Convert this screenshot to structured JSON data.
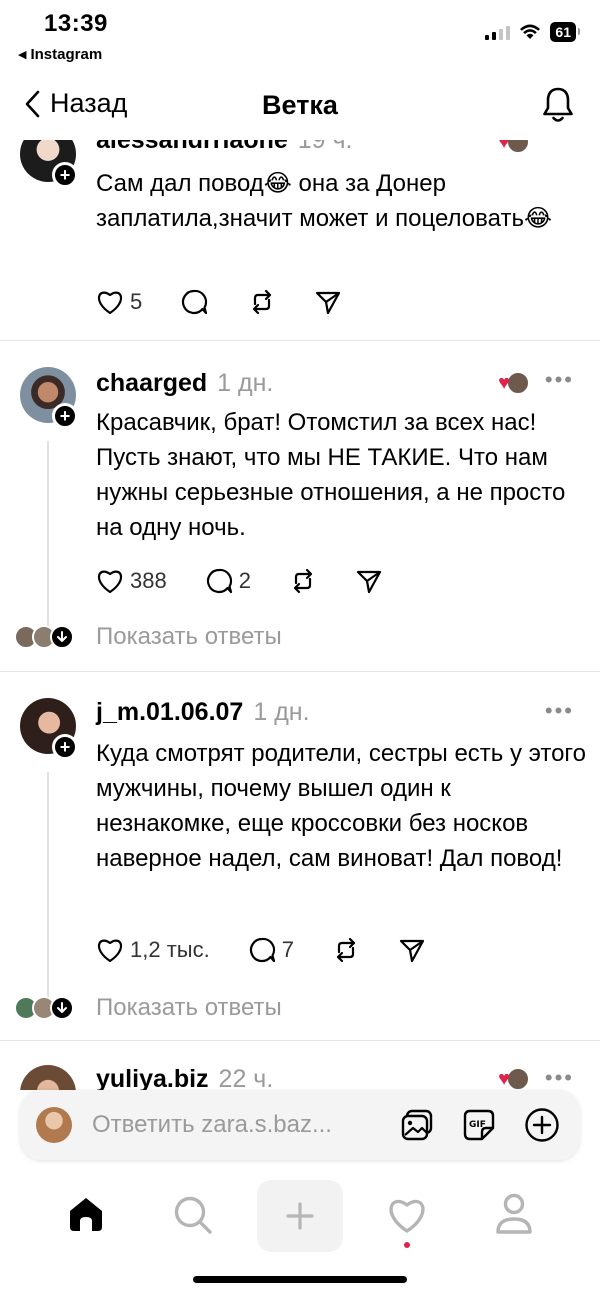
{
  "status_bar": {
    "time": "13:39",
    "back_app": "Instagram",
    "battery": "61"
  },
  "header": {
    "back_label": "Назад",
    "title": "Ветка"
  },
  "posts": [
    {
      "username": "alessandrriaone",
      "timestamp": "19 ч.",
      "text": "Сам дал повод😂 она за Донер заплатила,значит может и поцеловать😂",
      "likes": "5",
      "replies": ""
    },
    {
      "username": "chaarged",
      "timestamp": "1 дн.",
      "text": "Красавчик, брат! Отомстил за всех нас! Пусть знают, что мы НЕ ТАКИЕ. Что нам нужны серьезные отношения, а не просто на одну ночь.",
      "likes": "388",
      "replies": "2",
      "show_replies": "Показать ответы"
    },
    {
      "username": "j_m.01.06.07",
      "timestamp": "1 дн.",
      "text": "Куда смотрят родители, сестры есть у этого мужчины, почему вышел один к незнакомке,  еще кроссовки без носков наверное надел, сам виноват! Дал повод!",
      "likes": "1,2 тыс.",
      "replies": "7",
      "show_replies": "Показать ответы"
    },
    {
      "username": "yuliya.biz",
      "timestamp": "22 ч."
    }
  ],
  "reply_bar": {
    "placeholder": "Ответить zara.s.baz..."
  },
  "icons": {
    "like": "heart-outline-icon",
    "comment": "speech-bubble-icon",
    "repost": "repost-icon",
    "share": "paper-plane-icon",
    "nav": [
      "home-icon",
      "search-icon",
      "plus-icon",
      "heart-icon",
      "profile-icon"
    ]
  },
  "colors": {
    "accent_heart": "#e0234b",
    "muted_text": "#9a9a9a",
    "divider": "#e6e6e6"
  }
}
